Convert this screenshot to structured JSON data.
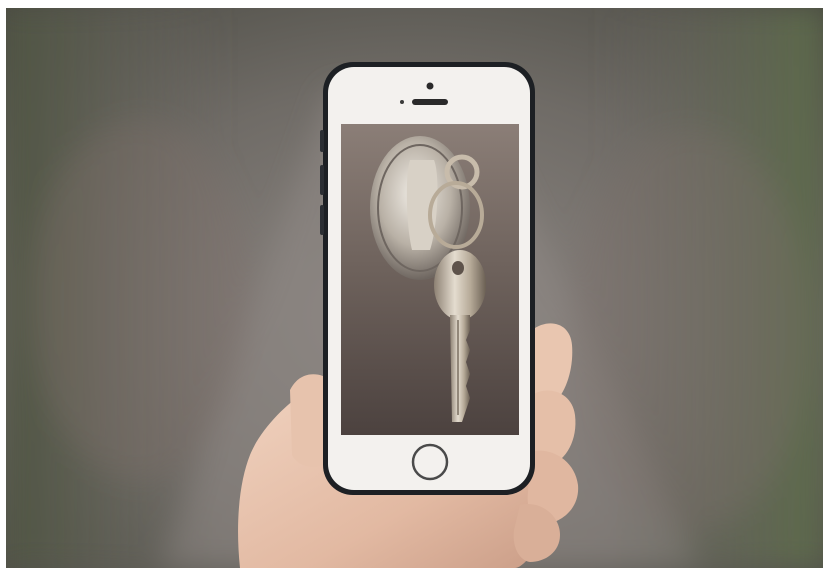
{
  "photo": {
    "subject": "hand-holding-smartphone",
    "screen_content": "key-in-lock",
    "colors": {
      "background_blur": "#6f6b66",
      "road_tone": "#8a8480",
      "foliage_tone": "#5f6850",
      "phone_body": "#f3f1ee",
      "phone_bezel": "#1d2024",
      "screen_bg": "#6a605a",
      "metal": "#c9c2b8",
      "skin": "#e8c4ae"
    }
  }
}
